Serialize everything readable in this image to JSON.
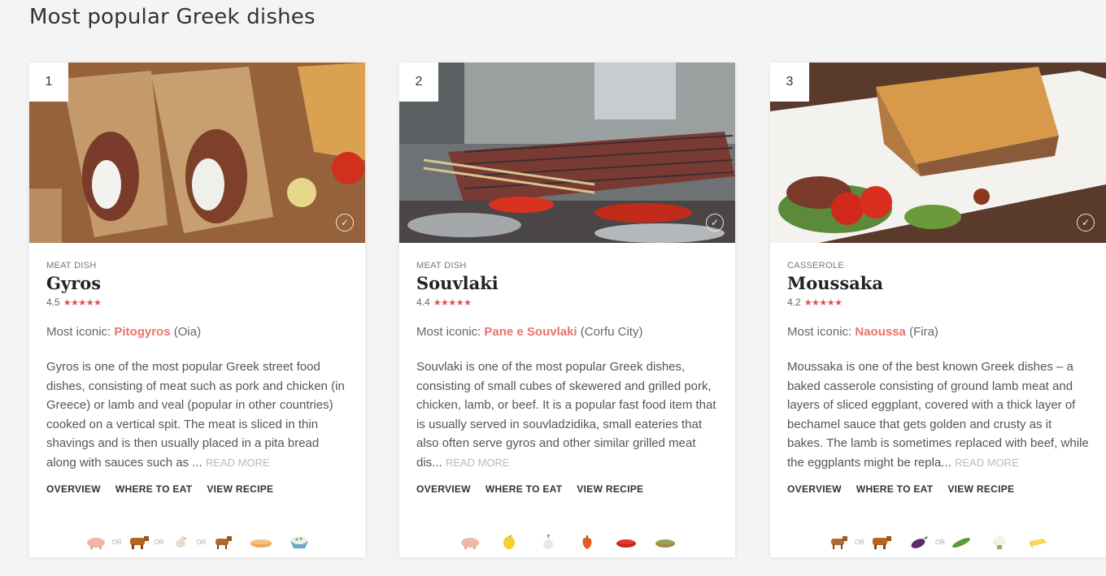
{
  "page": {
    "title": "Most popular Greek dishes"
  },
  "cards": [
    {
      "rank": "1",
      "category": "MEAT DISH",
      "name": "Gyros",
      "rating": "4.5",
      "iconic_prefix": "Most iconic:",
      "iconic_place": "Pitogyros",
      "iconic_city": "(Oia)",
      "description": "Gyros is one of the most popular Greek street food dishes, consisting of meat such as pork and chicken (in Greece) or lamb and veal (popular in other countries) cooked on a vertical spit. The meat is sliced in thin shavings and is then usually placed in a pita bread along with sauces such as ...",
      "read_more": "READ MORE",
      "actions": [
        "OVERVIEW",
        "WHERE TO EAT",
        "VIEW RECIPE"
      ],
      "ingredient_icons": [
        "pig-icon",
        "cow-icon",
        "chicken-icon",
        "lamb-icon",
        "pita-icon",
        "tzatziki-icon"
      ]
    },
    {
      "rank": "2",
      "category": "MEAT DISH",
      "name": "Souvlaki",
      "rating": "4.4",
      "iconic_prefix": "Most iconic:",
      "iconic_place": "Pane e Souvlaki",
      "iconic_city": "(Corfu City)",
      "description": "Souvlaki is one of the most popular Greek dishes, consisting of small cubes of skewered and grilled pork, chicken, lamb, or beef. It is a popular fast food item that is usually served in souvladzidika, small eateries that also often serve gyros and other similar grilled meat dis...",
      "read_more": "READ MORE",
      "actions": [
        "OVERVIEW",
        "WHERE TO EAT",
        "VIEW RECIPE"
      ],
      "ingredient_icons": [
        "pig-icon",
        "lemon-icon",
        "onion-icon",
        "pepper-icon",
        "paprika-icon",
        "oregano-icon"
      ]
    },
    {
      "rank": "3",
      "category": "CASSEROLE",
      "name": "Moussaka",
      "rating": "4.2",
      "iconic_prefix": "Most iconic:",
      "iconic_place": "Naoussa",
      "iconic_city": "(Fira)",
      "description": "Moussaka is one of the best known Greek dishes – a baked casserole consisting of ground lamb meat and layers of sliced eggplant, covered with a thick layer of bechamel sauce that gets golden and crusty as it bakes. The lamb is sometimes replaced with beef, while the eggplants might be repla...",
      "read_more": "READ MORE",
      "actions": [
        "OVERVIEW",
        "WHERE TO EAT",
        "VIEW RECIPE"
      ],
      "ingredient_icons": [
        "lamb-icon",
        "cow-icon",
        "eggplant-icon",
        "zucchini-icon",
        "cauliflower-icon",
        "butter-icon"
      ]
    }
  ],
  "or_label": "OR",
  "stars": "★★★★★",
  "colors": {
    "accent": "#e8756b",
    "star": "#d9534f"
  }
}
